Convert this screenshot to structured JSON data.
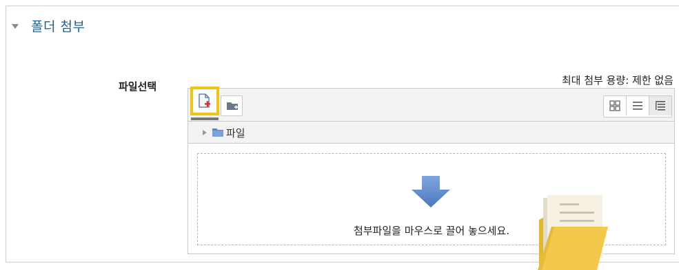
{
  "section": {
    "title": "폴더 첨부",
    "toggle_icon": "caret-down-icon"
  },
  "field": {
    "label": "파일선택"
  },
  "limit": {
    "text": "최대 첨부 용량: 제한 없음"
  },
  "filepicker": {
    "toolbar": {
      "add_icon": "add-file-icon",
      "create_folder_icon": "create-folder-icon",
      "views": [
        "view-icons-icon",
        "view-list-icon",
        "view-tree-icon"
      ],
      "highlight_color": "#f0c40f"
    },
    "path": {
      "folder_label": "파일"
    },
    "dropzone": {
      "text": "첨부파일을 마우스로 끌어 놓으세요.",
      "arrow_color": "#5b86c8"
    }
  },
  "decor": {
    "folder_color": "#f2c94c"
  }
}
